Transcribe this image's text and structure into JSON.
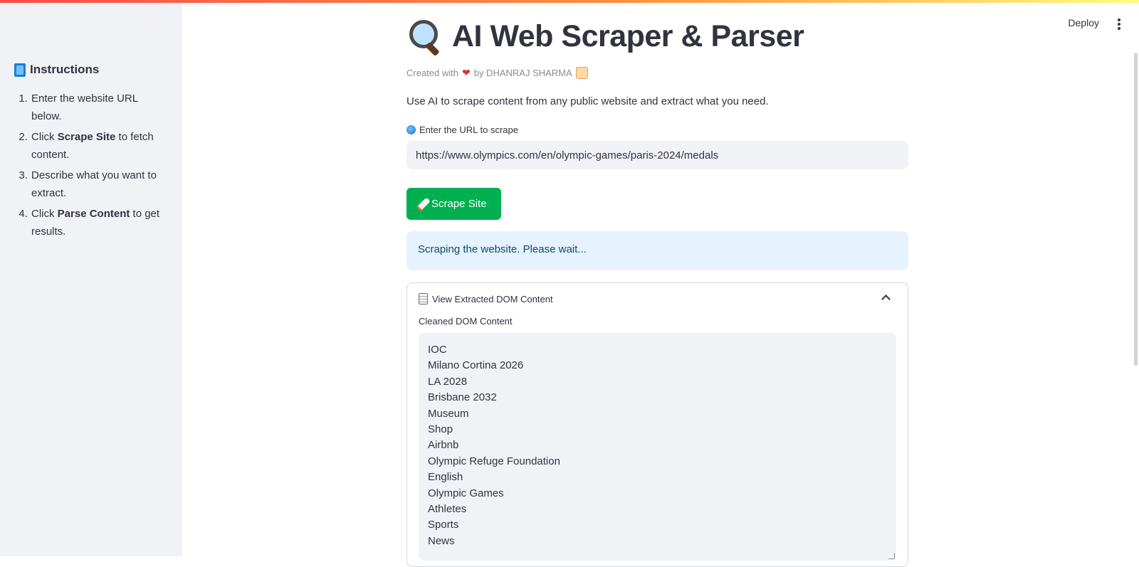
{
  "sidebar": {
    "heading": "Instructions",
    "steps": [
      {
        "pre": "Enter the website URL below.",
        "bold": "",
        "post": ""
      },
      {
        "pre": "Click ",
        "bold": "Scrape Site",
        "post": " to fetch content."
      },
      {
        "pre": "Describe what you want to extract.",
        "bold": "",
        "post": ""
      },
      {
        "pre": "Click ",
        "bold": "Parse Content",
        "post": " to get results."
      }
    ]
  },
  "header": {
    "deploy_label": "Deploy"
  },
  "main": {
    "title": "AI Web Scraper & Parser",
    "created_prefix": "Created with",
    "created_suffix": "by DHANRAJ SHARMA",
    "description": "Use AI to scrape content from any public website and extract what you need.",
    "url_label": "Enter the URL to scrape",
    "url_value": "https://www.olympics.com/en/olympic-games/paris-2024/medals",
    "scrape_button": "Scrape Site",
    "status_message": "Scraping the website. Please wait...",
    "expander_title": "View Extracted DOM Content",
    "textarea_label": "Cleaned DOM Content",
    "dom_lines": [
      "IOC",
      "Milano Cortina 2026",
      "LA 2028",
      "Brisbane 2032",
      "Museum",
      "Shop",
      "Airbnb",
      "Olympic Refuge Foundation",
      "English",
      "Olympic Games",
      "Athletes",
      "Sports",
      "News"
    ]
  },
  "colors": {
    "primary_button": "#00b050",
    "info_background": "#e6f2fd",
    "sidebar_background": "#f0f2f6"
  }
}
